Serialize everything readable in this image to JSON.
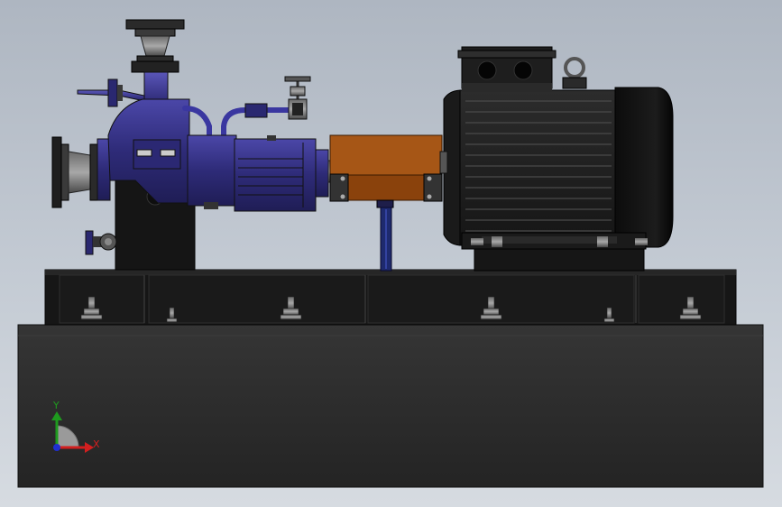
{
  "viewport": {
    "background_top": "#aeb6c1",
    "background_bottom": "#d6dbe1"
  },
  "colors": {
    "pump_body": "#2e2b78",
    "coupling_guard": "#a04e0e",
    "motor": "#1f1f1f",
    "base_frame": "#141414",
    "foundation": "#2a2a2a",
    "axis_x": "#d21f1f",
    "axis_y": "#1e9a1e",
    "axis_z": "#1f2fd0"
  },
  "triad": {
    "x_label": "X",
    "y_label": "Y",
    "x_color": "#d21f1f",
    "y_color": "#1e9a1e",
    "z_color": "#1f2fd0"
  }
}
